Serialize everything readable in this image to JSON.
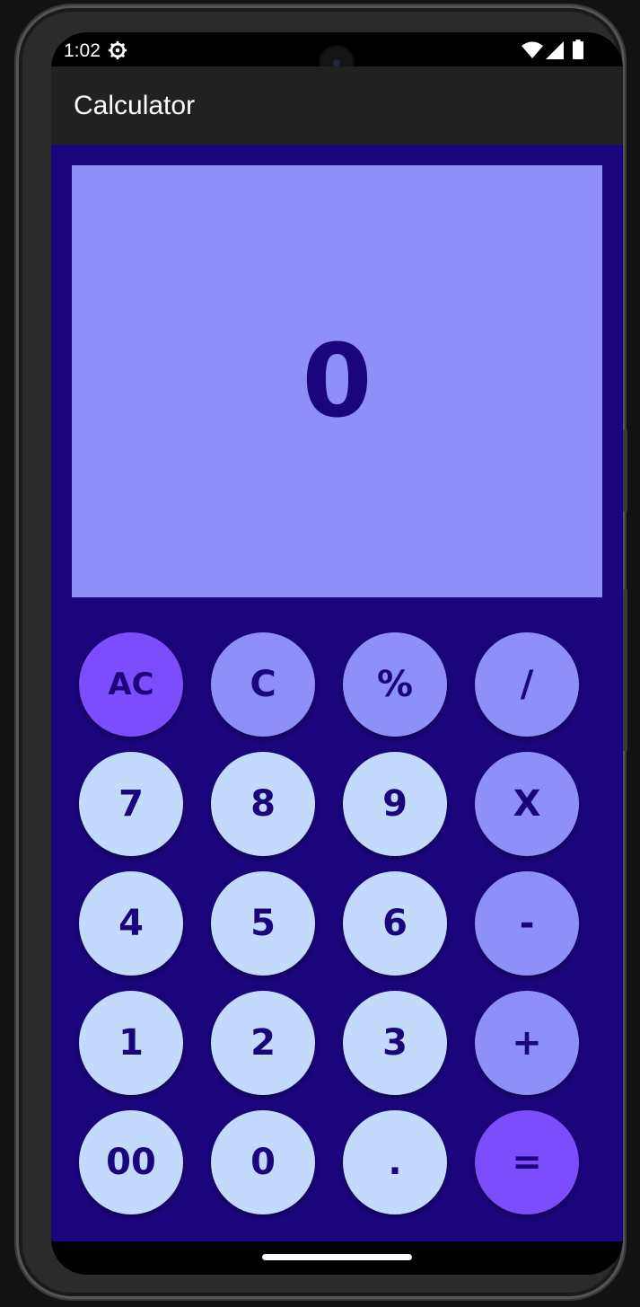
{
  "status_bar": {
    "time": "1:02",
    "icons": [
      "settings-gear-icon",
      "wifi-icon",
      "cellular-signal-icon",
      "battery-icon"
    ]
  },
  "app_bar": {
    "title": "Calculator"
  },
  "display": {
    "value": "0"
  },
  "keypad": {
    "row1": [
      "AC",
      "C",
      "%",
      "/"
    ],
    "row2": [
      "7",
      "8",
      "9",
      "X"
    ],
    "row3": [
      "4",
      "5",
      "6",
      "-"
    ],
    "row4": [
      "1",
      "2",
      "3",
      "+"
    ],
    "row5": [
      "00",
      "0",
      ".",
      "="
    ]
  },
  "colors": {
    "background": "#1b057c",
    "display": "#8f8ff9",
    "number_key": "#c3dafc",
    "operator_key": "#8f8ff9",
    "accent_key": "#7b4dfb",
    "app_bar": "#212121",
    "text": "#1b057c"
  }
}
